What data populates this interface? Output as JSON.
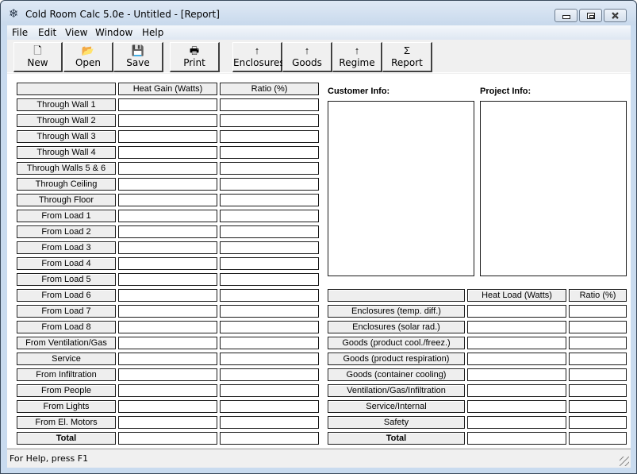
{
  "window": {
    "title": "Cold Room Calc 5.0e - Untitled - [Report]",
    "app_icon": "snowflake-icon",
    "controls": [
      "minimize",
      "maximize",
      "close"
    ]
  },
  "menu": [
    "File",
    "Edit",
    "View",
    "Window",
    "Help"
  ],
  "toolbar": [
    {
      "label": "New",
      "icon": "new-document-icon",
      "glyph": "🗋"
    },
    {
      "label": "Open",
      "icon": "open-folder-icon",
      "glyph": "📂"
    },
    {
      "label": "Save",
      "icon": "floppy-disk-icon",
      "glyph": "💾"
    },
    {
      "label": "Print",
      "icon": "printer-icon",
      "glyph": "🖶"
    },
    {
      "label": "Enclosures",
      "icon": "arrow-up-icon",
      "glyph": "↑"
    },
    {
      "label": "Goods",
      "icon": "arrow-up-icon",
      "glyph": "↑"
    },
    {
      "label": "Regime",
      "icon": "arrow-up-icon",
      "glyph": "↑"
    },
    {
      "label": "Report",
      "icon": "sigma-icon",
      "glyph": "Σ"
    }
  ],
  "heat_gain_table": {
    "headers": [
      "",
      "Heat Gain (Watts)",
      "Ratio (%)"
    ],
    "rows": [
      {
        "label": "Through Wall 1",
        "watts": "",
        "ratio": ""
      },
      {
        "label": "Through Wall 2",
        "watts": "",
        "ratio": ""
      },
      {
        "label": "Through Wall 3",
        "watts": "",
        "ratio": ""
      },
      {
        "label": "Through Wall 4",
        "watts": "",
        "ratio": ""
      },
      {
        "label": "Through Walls 5 & 6",
        "watts": "",
        "ratio": ""
      },
      {
        "label": "Through Ceiling",
        "watts": "",
        "ratio": ""
      },
      {
        "label": "Through Floor",
        "watts": "",
        "ratio": ""
      },
      {
        "label": "From Load 1",
        "watts": "",
        "ratio": ""
      },
      {
        "label": "From Load 2",
        "watts": "",
        "ratio": ""
      },
      {
        "label": "From Load 3",
        "watts": "",
        "ratio": ""
      },
      {
        "label": "From Load 4",
        "watts": "",
        "ratio": ""
      },
      {
        "label": "From Load 5",
        "watts": "",
        "ratio": ""
      },
      {
        "label": "From Load 6",
        "watts": "",
        "ratio": ""
      },
      {
        "label": "From Load 7",
        "watts": "",
        "ratio": ""
      },
      {
        "label": "From Load 8",
        "watts": "",
        "ratio": ""
      },
      {
        "label": "From Ventilation/Gas",
        "watts": "",
        "ratio": ""
      },
      {
        "label": "Service",
        "watts": "",
        "ratio": ""
      },
      {
        "label": "From Infiltration",
        "watts": "",
        "ratio": ""
      },
      {
        "label": "From People",
        "watts": "",
        "ratio": ""
      },
      {
        "label": "From Lights",
        "watts": "",
        "ratio": ""
      },
      {
        "label": "From El. Motors",
        "watts": "",
        "ratio": ""
      },
      {
        "label": "Total",
        "watts": "",
        "ratio": "",
        "bold": true
      }
    ]
  },
  "customer_info": {
    "label": "Customer Info:",
    "value": ""
  },
  "project_info": {
    "label": "Project Info:",
    "value": ""
  },
  "heat_load_table": {
    "headers": [
      "",
      "Heat Load (Watts)",
      "Ratio (%)"
    ],
    "rows": [
      {
        "label": "Enclosures (temp. diff.)",
        "watts": "",
        "ratio": ""
      },
      {
        "label": "Enclosures (solar rad.)",
        "watts": "",
        "ratio": ""
      },
      {
        "label": "Goods (product cool./freez.)",
        "watts": "",
        "ratio": ""
      },
      {
        "label": "Goods (product respiration)",
        "watts": "",
        "ratio": ""
      },
      {
        "label": "Goods (container cooling)",
        "watts": "",
        "ratio": ""
      },
      {
        "label": "Ventilation/Gas/Infiltration",
        "watts": "",
        "ratio": ""
      },
      {
        "label": "Service/Internal",
        "watts": "",
        "ratio": ""
      },
      {
        "label": "Safety",
        "watts": "",
        "ratio": ""
      },
      {
        "label": "Total",
        "watts": "",
        "ratio": "",
        "bold": true
      }
    ]
  },
  "status_bar": {
    "text": "For Help, press F1"
  }
}
